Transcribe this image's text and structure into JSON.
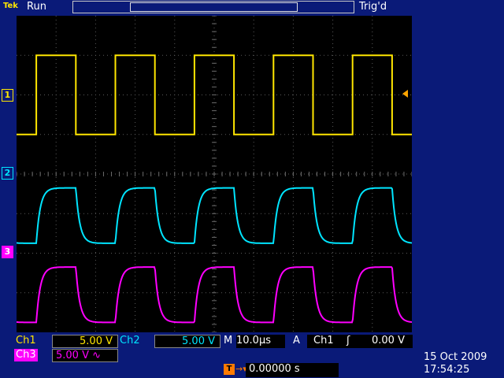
{
  "header": {
    "brand": "Tek",
    "status": "Run",
    "trigger_state": "Trig'd"
  },
  "channels": {
    "ch1": {
      "marker": "1",
      "label": "Ch1",
      "scale": "5.00 V",
      "color": "#ffe600"
    },
    "ch2": {
      "marker": "2",
      "label": "Ch2",
      "scale": "5.00 V",
      "color": "#00e5ff"
    },
    "ch3": {
      "marker": "3",
      "label": "Ch3",
      "scale": "5.00 V",
      "coupling_icon": "∿",
      "color": "#ff00ff"
    }
  },
  "horizontal": {
    "timebase_prefix": "M",
    "timebase": "10.0µs",
    "trigger_position_icon": "T→▾",
    "trigger_position": "0.00000 s"
  },
  "trigger": {
    "mode_label": "A",
    "source": "Ch1",
    "slope_icon": "rising-edge-icon",
    "slope_glyph": "ʃ",
    "level": "0.00 V",
    "marker": "T"
  },
  "datetime": {
    "date": "15 Oct  2009",
    "time": "17:54:25"
  },
  "waveforms": {
    "period_divisions": 2,
    "ch1": {
      "high_div": 3.0,
      "low_div": 1.0
    },
    "ch2": {
      "high_div": -0.35,
      "low_div": -1.75,
      "rise_tau_div": 0.05
    },
    "ch3": {
      "high_div": -2.35,
      "low_div": -3.75,
      "rise_tau_div": 0.05
    }
  }
}
